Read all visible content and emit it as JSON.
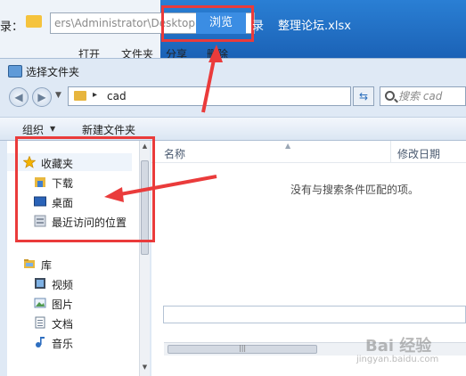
{
  "background": {
    "path_label": "录：",
    "path_text": "ers\\Administrator\\Desktop",
    "browse_label": "浏览",
    "desktop_fragment": "录",
    "xlsx_file": "整理论坛.xlsx",
    "menu_items": [
      "打开",
      "文件夹",
      "分享",
      "删除"
    ]
  },
  "dialog": {
    "title": "选择文件夹",
    "address": {
      "current_folder": "cad",
      "separator": "▸"
    },
    "search": {
      "placeholder": "搜索 cad"
    },
    "toolbar": {
      "organize_label": "组织",
      "new_folder_label": "新建文件夹"
    },
    "nav": {
      "favorites": "收藏夹",
      "favorites_items": [
        "下载",
        "桌面",
        "最近访问的位置"
      ],
      "libraries": "库",
      "library_items": [
        "视频",
        "图片",
        "文档",
        "音乐"
      ]
    },
    "file_list": {
      "col_name": "名称",
      "col_date": "修改日期",
      "empty_message": "没有与搜索条件匹配的项。"
    }
  },
  "annotations": {
    "color": "#ea3b3b"
  },
  "watermark": {
    "text": "Bai 经验",
    "sub": "jingyan.baidu.com"
  }
}
